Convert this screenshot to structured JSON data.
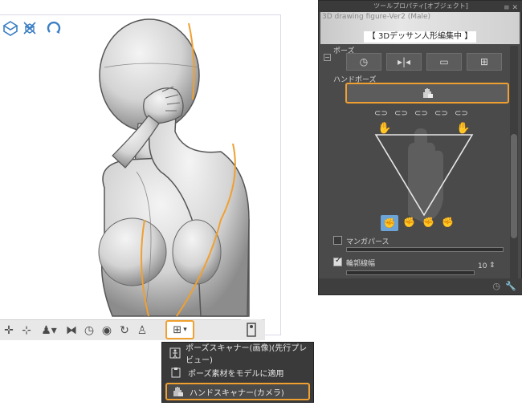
{
  "canvas": {
    "top_icons": [
      "move-3d-icon",
      "rotate-3d-icon",
      "magnet-icon"
    ]
  },
  "toolbar": {
    "icons": [
      "crosshair-icon",
      "camera-move-icon",
      "pose-dropdown-icon",
      "flip-icon",
      "reset-icon",
      "lock-icon",
      "rotate-icon",
      "pose-icon"
    ],
    "scanner_icon": "pose-scanner-icon",
    "extra_icon": "figure-settings-icon"
  },
  "menu": {
    "items": [
      {
        "label": "ポーズスキャナー(画像)(先行プレビュー)",
        "icon": "person-frame-icon"
      },
      {
        "label": "ポーズ素材をモデルに適用",
        "icon": "clipboard-icon"
      },
      {
        "label": "ハンドスキャナー(カメラ)",
        "icon": "hand-camera-icon"
      }
    ]
  },
  "panel": {
    "title": "ツールプロパティ[オブジェクト]",
    "subtool_name": "3D drawing figure-Ver2 (Male)",
    "badge": "【 3Dデッサン人形編集中 】",
    "pose_label": "ポーズ",
    "hand_pose_label": "ハンドポーズ",
    "manga_perspective_label": "マンガパース",
    "outline_label": "輪郭線幅",
    "outline_value": "10",
    "accent_color": "#f0a030"
  }
}
